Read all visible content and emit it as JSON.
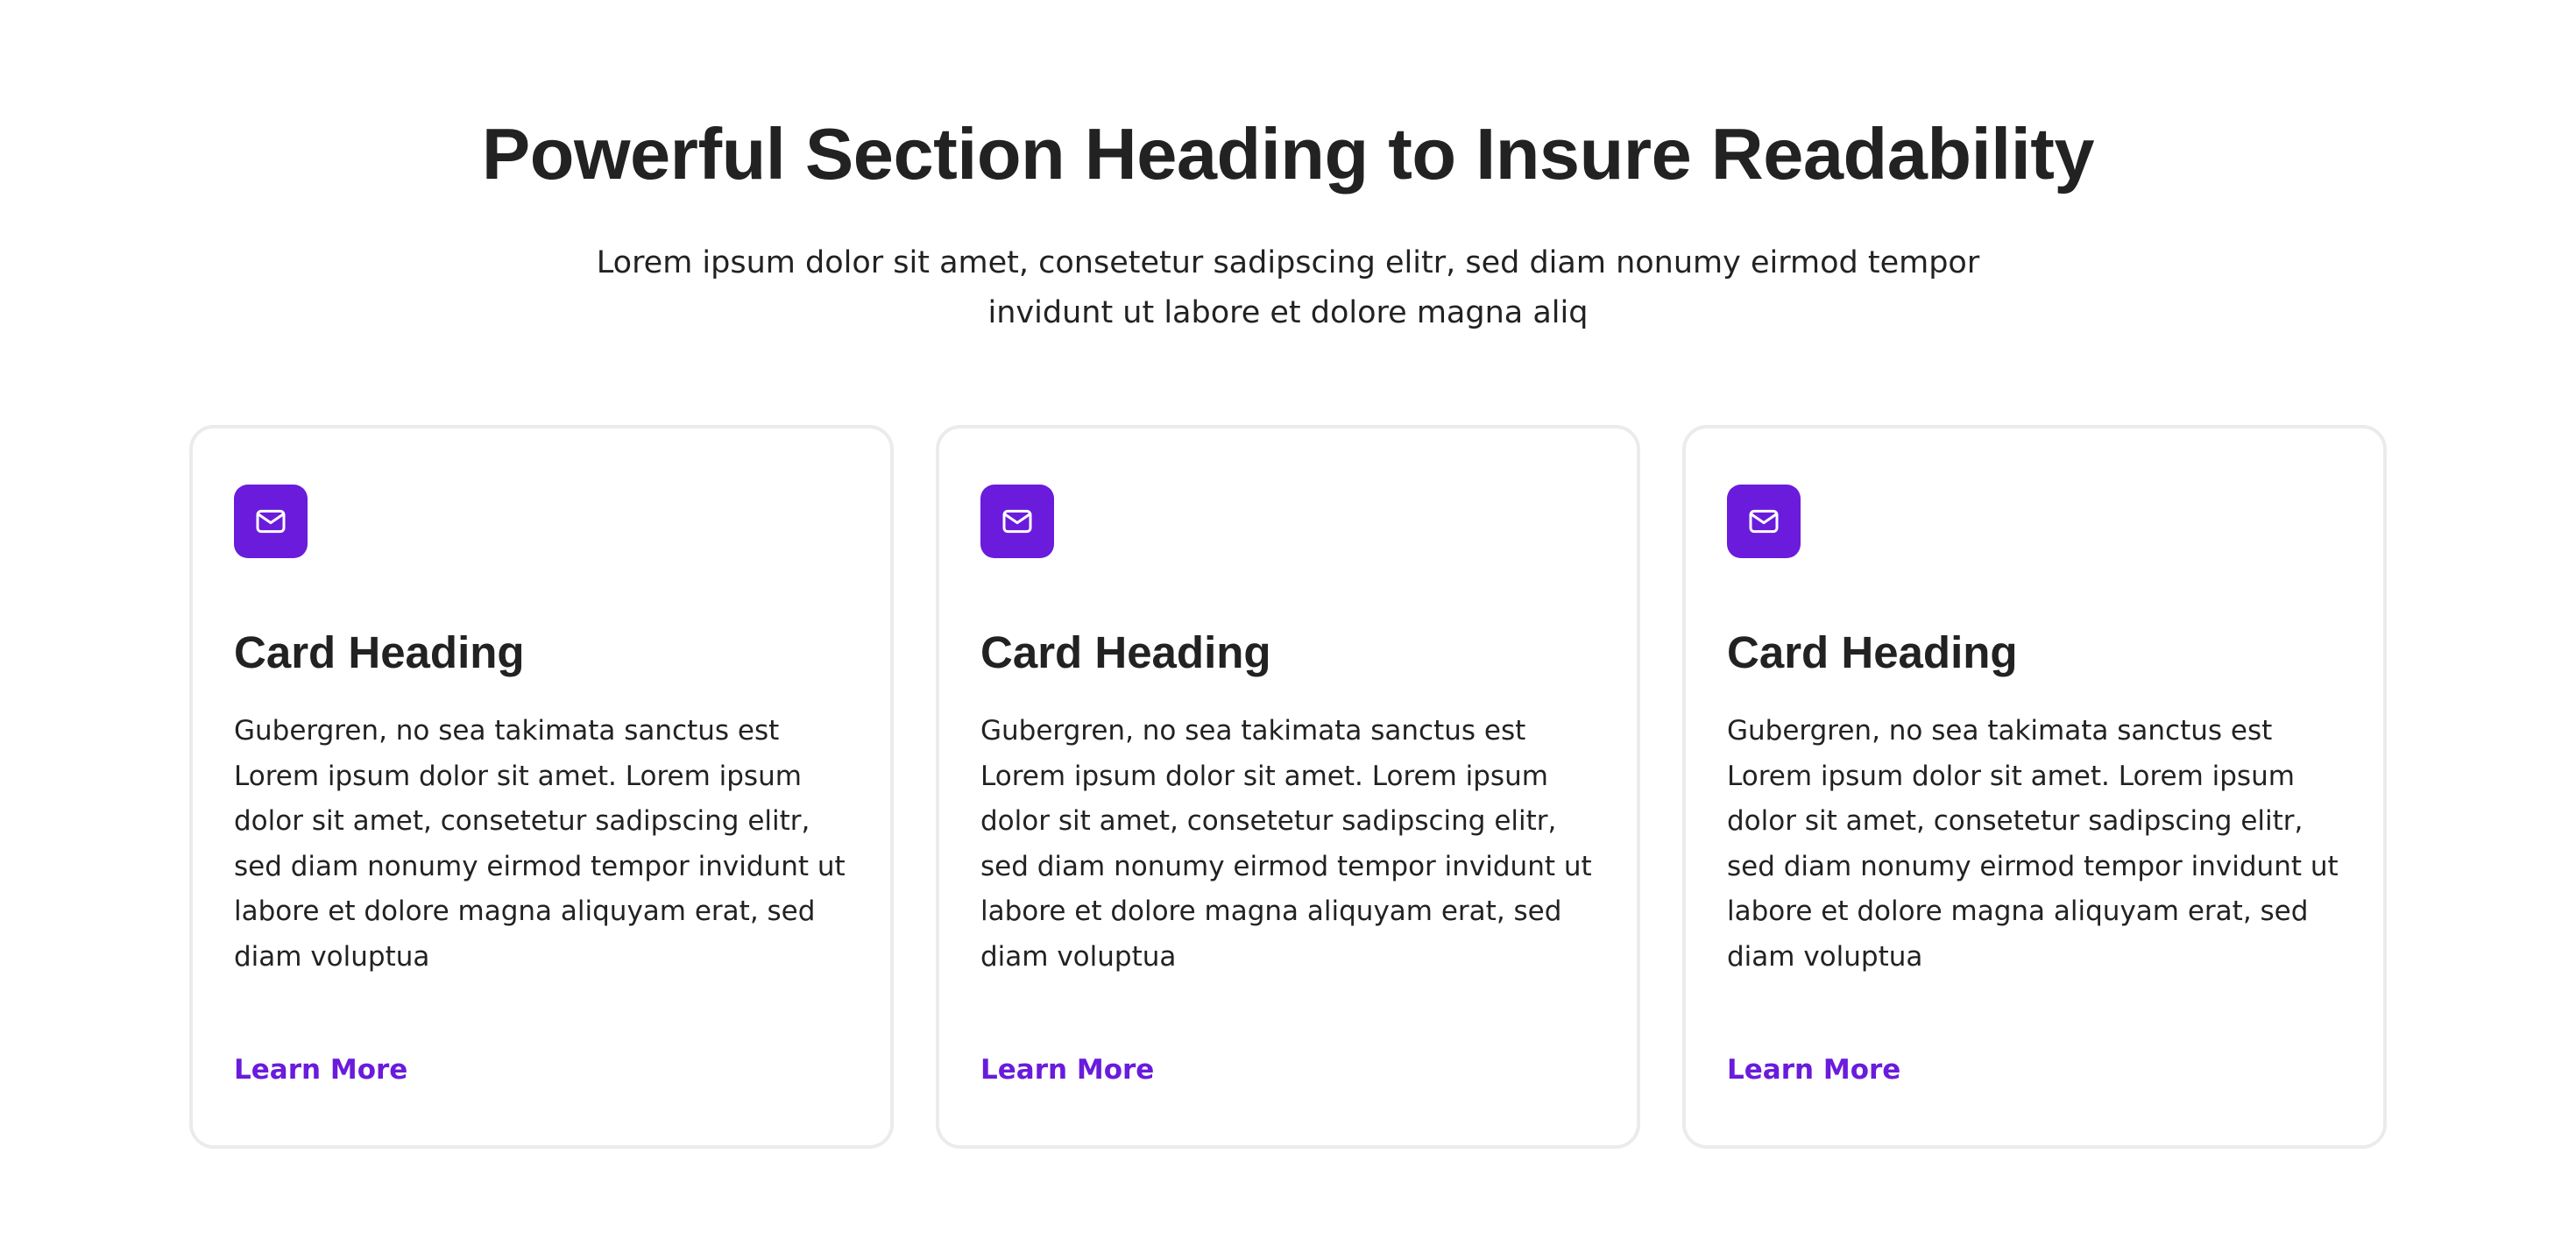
{
  "section": {
    "heading": "Powerful Section Heading to Insure Readability",
    "subtitle": "Lorem ipsum dolor sit amet, consetetur sadipscing elitr, sed diam nonumy eirmod tempor invidunt ut labore et dolore magna aliq"
  },
  "colors": {
    "accent": "#6a1bdc",
    "text": "#222222",
    "card_border": "#ebebeb"
  },
  "cards": [
    {
      "icon": "mail-icon",
      "heading": "Card Heading",
      "text": "Gubergren, no sea takimata sanctus est Lorem ipsum dolor sit amet. Lorem ipsum dolor sit amet, consetetur sadipscing elitr, sed diam nonumy eirmod tempor invidunt ut labore et dolore magna aliquyam erat, sed diam voluptua",
      "link_label": "Learn More"
    },
    {
      "icon": "mail-icon",
      "heading": "Card Heading",
      "text": "Gubergren, no sea takimata sanctus est Lorem ipsum dolor sit amet. Lorem ipsum dolor sit amet, consetetur sadipscing elitr, sed diam nonumy eirmod tempor invidunt ut labore et dolore magna aliquyam erat, sed diam voluptua",
      "link_label": "Learn More"
    },
    {
      "icon": "mail-icon",
      "heading": "Card Heading",
      "text": "Gubergren, no sea takimata sanctus est Lorem ipsum dolor sit amet. Lorem ipsum dolor sit amet, consetetur sadipscing elitr, sed diam nonumy eirmod tempor invidunt ut labore et dolore magna aliquyam erat, sed diam voluptua",
      "link_label": "Learn More"
    }
  ]
}
